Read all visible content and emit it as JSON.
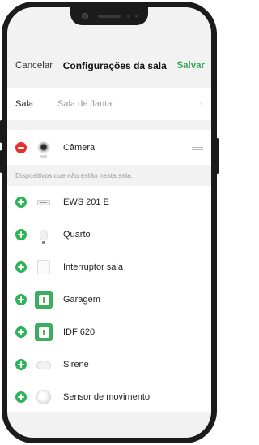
{
  "header": {
    "cancel_label": "Cancelar",
    "title": "Configurações da sala",
    "save_label": "Salvar"
  },
  "room": {
    "label": "Sala",
    "value": "Sala de Jantar",
    "chevron": "›"
  },
  "in_room": [
    {
      "name": "Câmera",
      "icon": "camera-icon",
      "action": "remove"
    }
  ],
  "section_note": "Dispositivos que não estão nesta sala.",
  "available": [
    {
      "name": "EWS 201 E",
      "icon": "strip-device-icon",
      "action": "add"
    },
    {
      "name": "Quarto",
      "icon": "bulb-icon",
      "action": "add"
    },
    {
      "name": "Interruptor sala",
      "icon": "switch-icon",
      "action": "add"
    },
    {
      "name": "Garagem",
      "icon": "tuya-app-icon",
      "action": "add"
    },
    {
      "name": "IDF 620",
      "icon": "tuya-app-icon",
      "action": "add"
    },
    {
      "name": "Sirene",
      "icon": "siren-icon",
      "action": "add"
    },
    {
      "name": "Sensor de movimento",
      "icon": "motion-sensor-icon",
      "action": "add"
    }
  ],
  "colors": {
    "accent_green": "#3aa757",
    "remove_red": "#e8312f",
    "add_green": "#2fb45a",
    "background": "#f2f2f2"
  }
}
